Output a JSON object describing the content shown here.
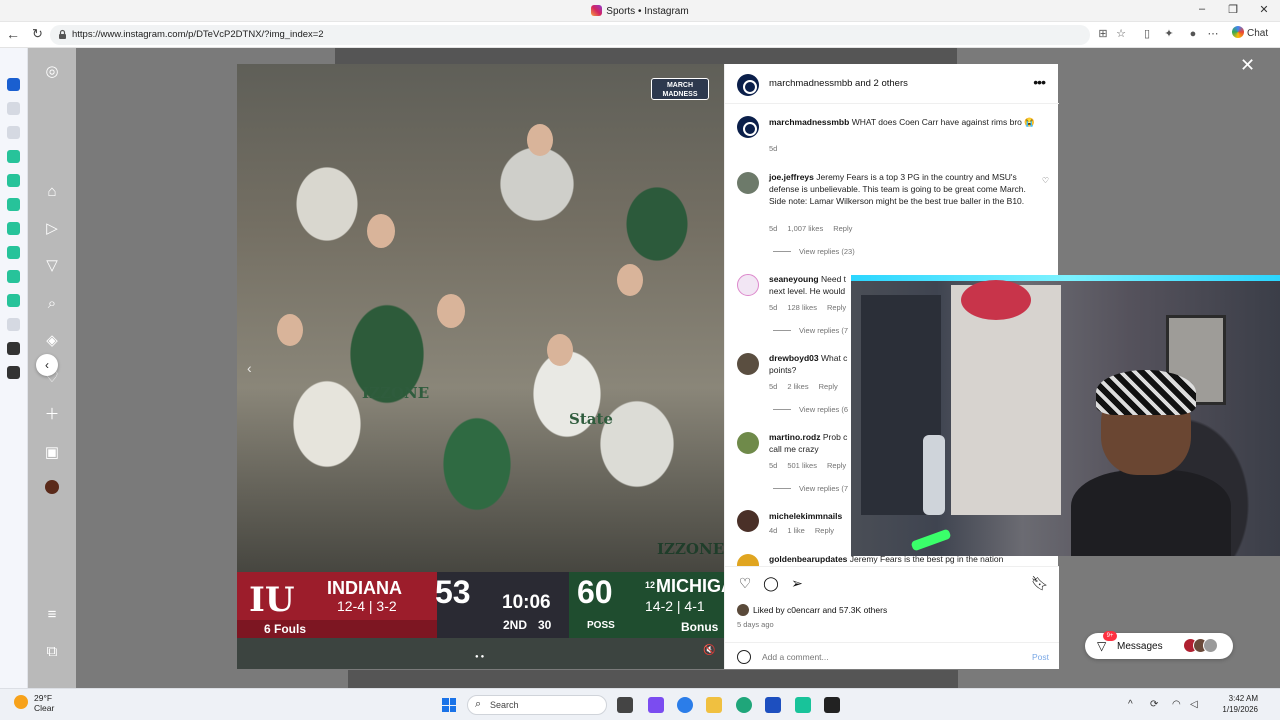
{
  "window": {
    "title": "Sports • Instagram"
  },
  "browser": {
    "url": "https://www.instagram.com/p/DTeVcP2DTNX/?img_index=2",
    "chat_label": "Chat"
  },
  "scoreboard": {
    "home_team": "INDIANA",
    "home_record": "12-4 | 3-2",
    "home_score": "53",
    "away_team": "MICHIGAN",
    "away_seed": "12",
    "away_record": "14-2 | 4-1",
    "away_score": "60",
    "clock": "10:06",
    "period": "2ND",
    "shot_clock": "30",
    "poss": "POSS",
    "fouls": "6 Fouls",
    "bonus": "Bonus",
    "logo_text": "IU"
  },
  "video": {
    "shirt_text_1": "IZZONE",
    "shirt_text_2": "State",
    "shirt_text_3": "IZZONE",
    "badge": "MARCH MADNESS"
  },
  "post": {
    "header": "marchmadnessmbb and 2 others",
    "comments": [
      {
        "user": "marchmadnessmbb",
        "text": "WHAT does Coen Carr have against rims bro 😭",
        "age": "5d"
      },
      {
        "user": "joe.jeffreys",
        "text": "Jeremy Fears is a top 3 PG in the country and MSU's defense is unbelievable. This team is going to be great come March. Side note: Lamar Wilkerson might be the best true baller in the B10.",
        "age": "5d",
        "likes": "1,007 likes",
        "reply": "Reply",
        "view_replies": "View replies (23)"
      },
      {
        "user": "seaneyoung",
        "text": "Need t",
        "text2": "next level. He would",
        "age": "5d",
        "likes": "128 likes",
        "reply": "Reply",
        "view_replies": "View replies (7"
      },
      {
        "user": "drewboyd03",
        "text": "What c",
        "text2": "points?",
        "age": "5d",
        "likes": "2 likes",
        "reply": "Reply",
        "view_replies": "View replies (6"
      },
      {
        "user": "martino.rodz",
        "text": "Prob c",
        "text2": "call me crazy",
        "age": "5d",
        "likes": "501 likes",
        "reply": "Reply",
        "view_replies": "View replies (7"
      },
      {
        "user": "michelekimmnails",
        "text": "",
        "age": "4d",
        "likes": "1 like",
        "reply": "Reply"
      },
      {
        "user": "goldenbearupdates",
        "text": "Jeremy Fears is the best pg in the nation"
      }
    ],
    "liked_by": "Liked by c0encarr and 57.3K others",
    "ago": "5 days ago",
    "add_comment_placeholder": "Add a comment...",
    "post_label": "Post"
  },
  "messages": {
    "label": "Messages",
    "badge": "9+"
  },
  "taskbar": {
    "temp": "29°F",
    "condition": "Clear",
    "search": "Search",
    "time": "3:42 AM",
    "date": "1/19/2026"
  },
  "icons": {
    "back": "back-arrow-icon",
    "reload": "reload-icon",
    "lock": "lock-icon",
    "like": "heart-icon",
    "comment": "comment-icon",
    "share": "share-icon",
    "save": "bookmark-icon"
  }
}
